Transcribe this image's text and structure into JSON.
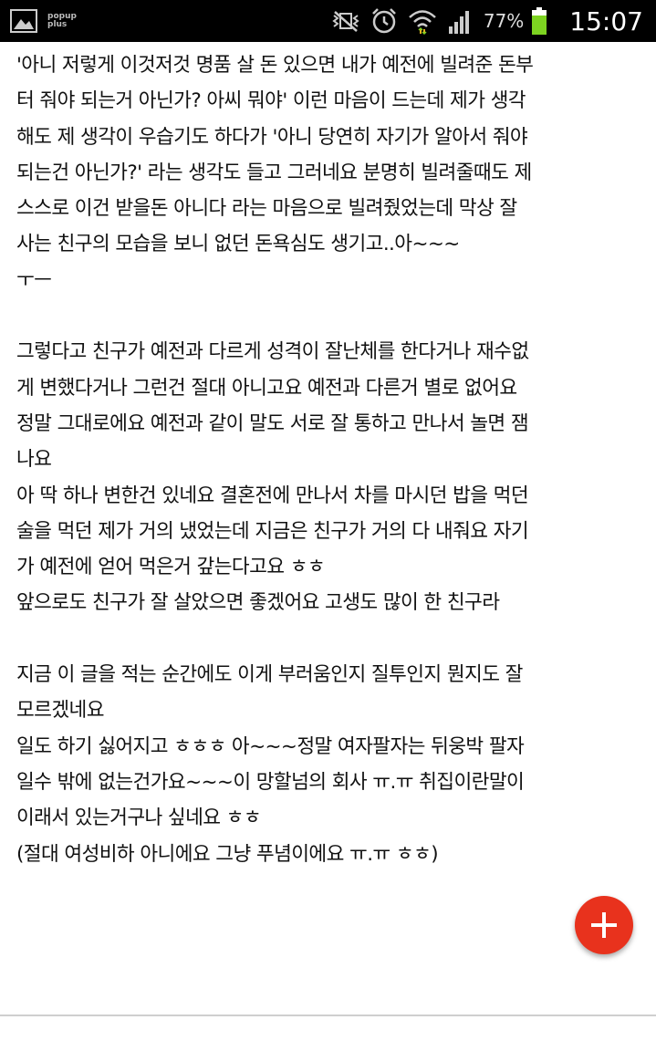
{
  "status_bar": {
    "app_logo_line1": "popup",
    "app_logo_line2": "plus",
    "battery_percent": "77%",
    "time": "15:07",
    "battery_color": "#7dd321"
  },
  "post": {
    "lines": [
      "'아니 저렇게 이것저것 명품 살 돈 있으면 내가 예전에 빌려준 돈부",
      "터 줘야 되는거 아닌가? 아씨 뭐야' 이런 마음이 드는데 제가 생각",
      "해도 제 생각이 우습기도 하다가 '아니 당연히 자기가 알아서 줘야",
      "되는건 아닌가?' 라는 생각도 들고 그러네요 분명히 빌려줄때도 제",
      "스스로 이건 받을돈 아니다 라는 마음으로 빌려줬었는데 막상 잘",
      "사는 친구의 모습을 보니 없던 돈욕심도 생기고..아~~~",
      "ㅜㅡ",
      "",
      "그렇다고 친구가 예전과 다르게 성격이 잘난체를 한다거나 재수없",
      "게 변했다거나 그런건 절대 아니고요 예전과 다른거 별로 없어요",
      "정말 그대로에요 예전과 같이 말도 서로 잘 통하고 만나서 놀면 잼",
      "나요",
      "아 딱 하나 변한건 있네요 결혼전에 만나서 차를 마시던 밥을 먹던",
      "술을 먹던 제가 거의 냈었는데 지금은 친구가 거의 다 내줘요 자기",
      "가 예전에 얻어 먹은거 갚는다고요 ㅎㅎ",
      "앞으로도 친구가 잘 살았으면 좋겠어요 고생도 많이 한 친구라",
      "",
      "지금 이 글을 적는 순간에도 이게 부러움인지 질투인지 뭔지도 잘",
      "모르겠네요",
      "일도 하기 싫어지고 ㅎㅎㅎ 아~~~정말 여자팔자는 뒤웅박 팔자",
      "일수 밖에 없는건가요~~~이 망할넘의 회사 ㅠ.ㅠ 취집이란말이",
      "이래서 있는거구나 싶네요 ㅎㅎ",
      "(절대 여성비하 아니에요 그냥 푸념이에요 ㅠ.ㅠ ㅎㅎ)"
    ]
  },
  "fab": {
    "icon": "plus-icon",
    "color": "#e8321d"
  }
}
